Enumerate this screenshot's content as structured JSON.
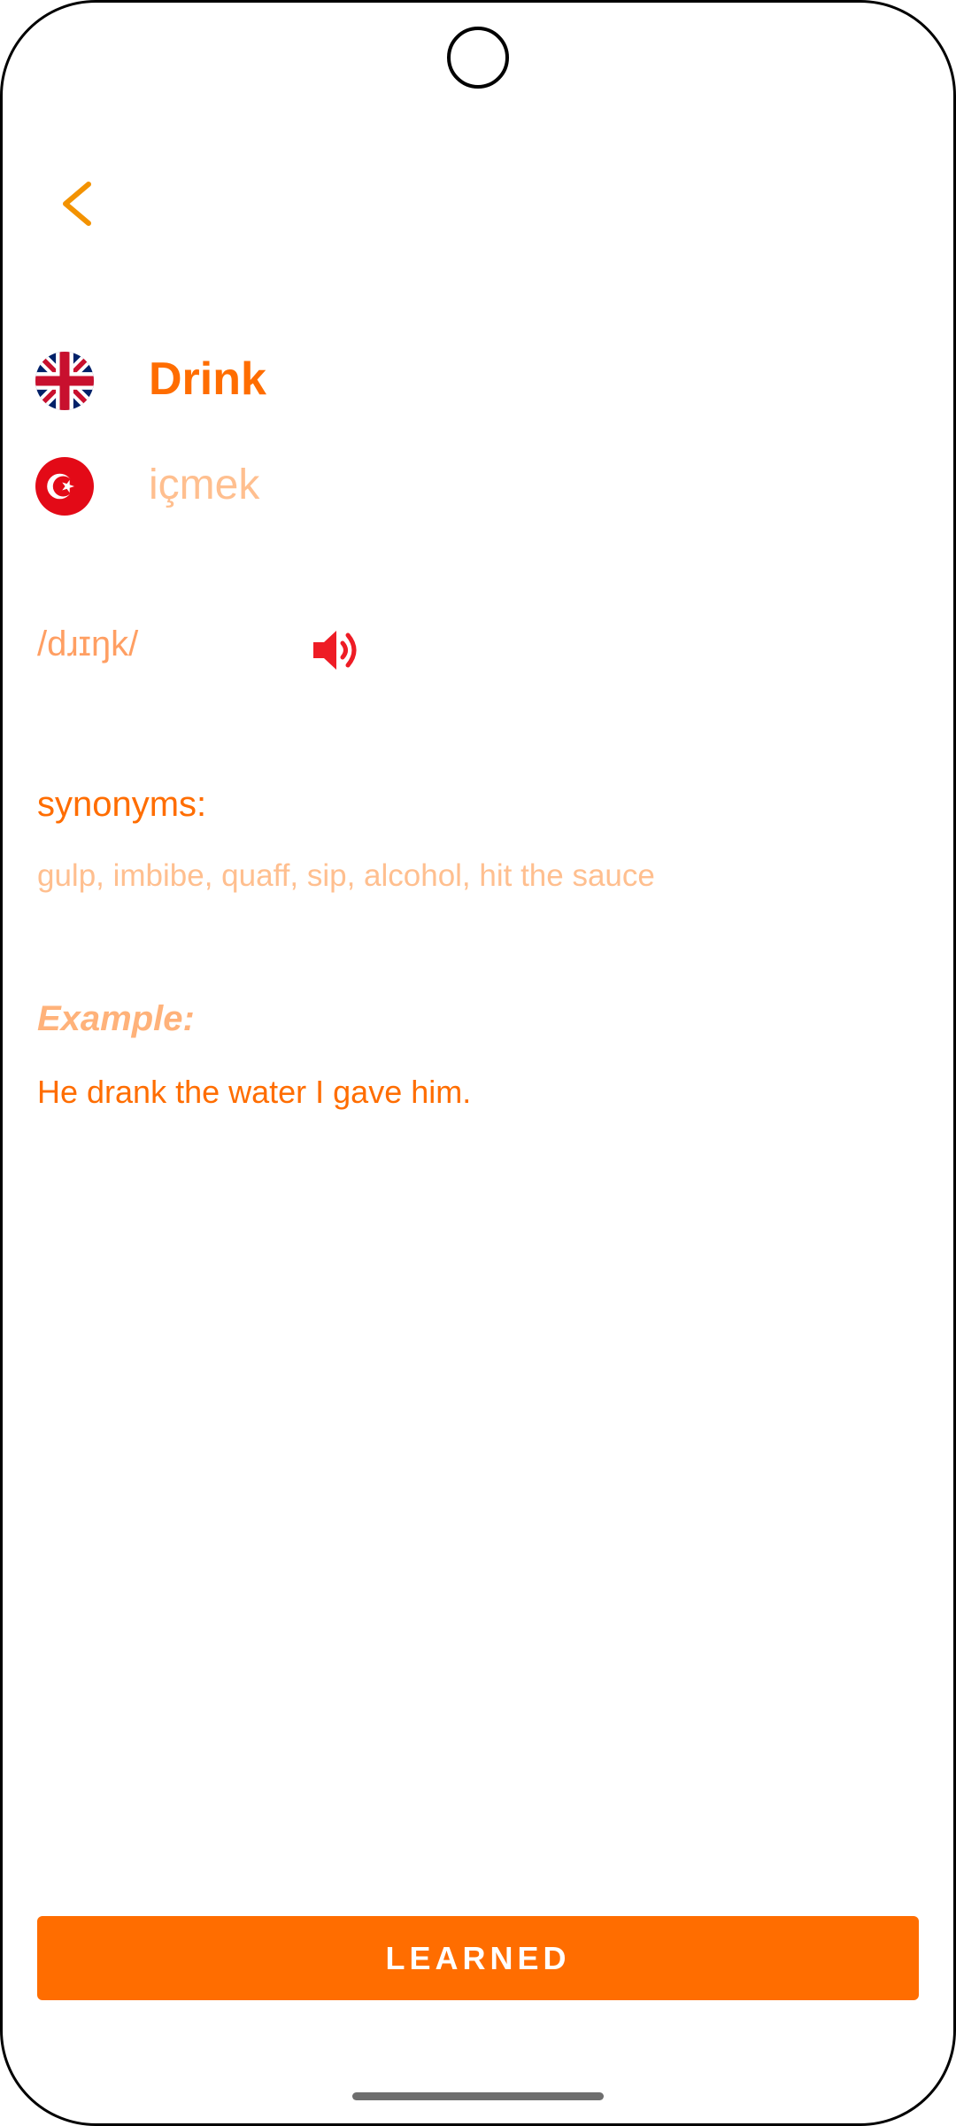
{
  "header": {
    "back_icon": "chevron-left-icon"
  },
  "word": {
    "source_flag": "uk-flag-icon",
    "text": "Drink",
    "target_flag": "turkey-flag-icon",
    "translation": "içmek"
  },
  "pronunciation": {
    "phonetic": "/dɹɪŋk/",
    "speaker_icon": "speaker-icon"
  },
  "synonyms": {
    "label": "synonyms:",
    "text": "gulp, imbibe, quaff, sip, alcohol, hit the sauce"
  },
  "example": {
    "label_word": "Example",
    "label_colon": ":",
    "text": "He drank the water I gave him."
  },
  "action": {
    "learned_label": "LEARNED"
  },
  "colors": {
    "primary": "#ff6d00",
    "light": "#ffbf8f",
    "back_arrow": "#f39200",
    "speaker": "#ee1c25"
  }
}
